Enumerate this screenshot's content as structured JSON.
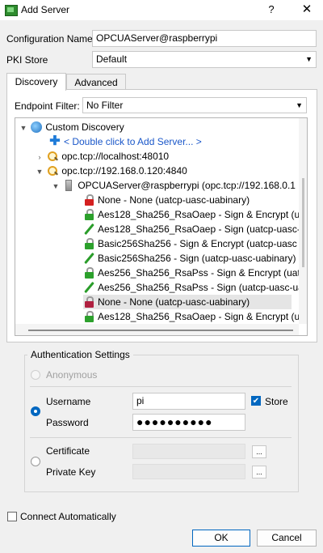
{
  "window": {
    "title": "Add Server",
    "help_label": "?",
    "close_label": "✕"
  },
  "form": {
    "configuration_name_label": "Configuration Name",
    "configuration_name_value": "OPCUAServer@raspberrypi",
    "pki_store_label": "PKI Store",
    "pki_store_value": "Default"
  },
  "tabs": {
    "discovery": "Discovery",
    "advanced": "Advanced"
  },
  "discovery": {
    "endpoint_filter_label": "Endpoint Filter:",
    "endpoint_filter_value": "No Filter",
    "tree": {
      "custom_discovery": "Custom Discovery",
      "add_server_hint": "< Double click to Add Server... >",
      "localhost": "opc.tcp://localhost:48010",
      "remote": "opc.tcp://192.168.0.120:4840",
      "server_node": "OPCUAServer@raspberrypi (opc.tcp://192.168.0.1",
      "endpoints": [
        "None - None (uatcp-uasc-uabinary)",
        "Aes128_Sha256_RsaOaep - Sign & Encrypt (ua",
        "Aes128_Sha256_RsaOaep - Sign (uatcp-uasc-u",
        "Basic256Sha256 - Sign & Encrypt (uatcp-uasc",
        "Basic256Sha256 - Sign (uatcp-uasc-uabinary)",
        "Aes256_Sha256_RsaPss - Sign & Encrypt (uatc",
        "Aes256_Sha256_RsaPss - Sign (uatcp-uasc-uab",
        "None - None (uatcp-uasc-uabinary)",
        "Aes128_Sha256_RsaOaep - Sign & Encrypt (ua"
      ]
    }
  },
  "auth": {
    "group_title": "Authentication Settings",
    "anonymous_label": "Anonymous",
    "username_label": "Username",
    "username_value": "pi",
    "store_label": "Store",
    "password_label": "Password",
    "password_value": "●●●●●●●●●●",
    "certificate_label": "Certificate",
    "private_key_label": "Private Key",
    "browse_label": "..."
  },
  "footer": {
    "connect_automatically_label": "Connect Automatically",
    "ok_label": "OK",
    "cancel_label": "Cancel"
  }
}
